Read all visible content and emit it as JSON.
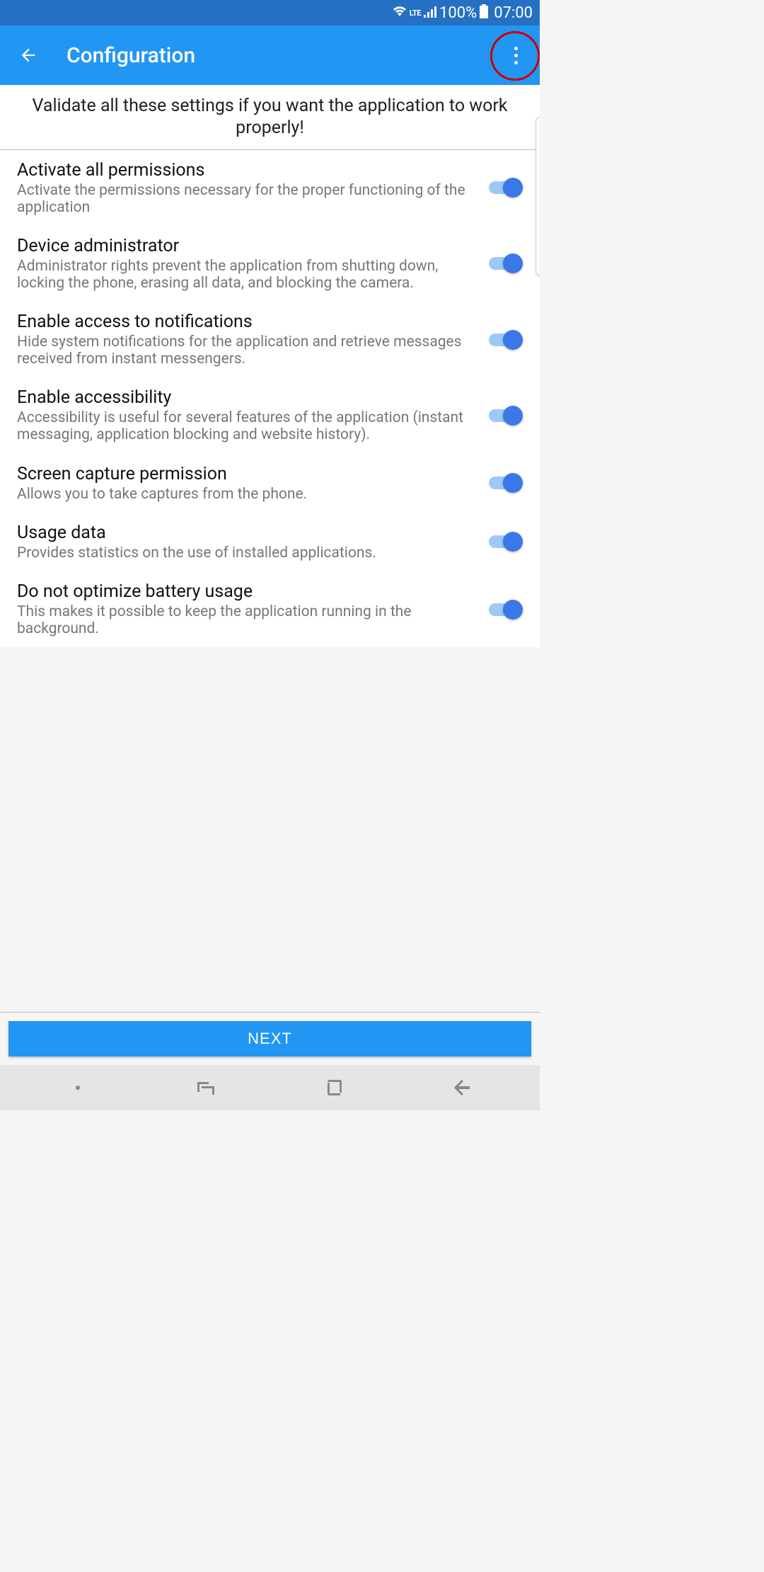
{
  "statusBar": {
    "network": "LTE",
    "batteryPct": "100%",
    "time": "07:00"
  },
  "header": {
    "title": "Configuration"
  },
  "instruction": "Validate all these settings if you want the application to work properly!",
  "settings": [
    {
      "title": "Activate all permissions",
      "desc": "Activate the permissions necessary for the proper functioning of the application",
      "on": true
    },
    {
      "title": "Device administrator",
      "desc": "Administrator rights prevent the application from shutting down, locking the phone, erasing all data, and blocking the camera.",
      "on": true
    },
    {
      "title": "Enable access to notifications",
      "desc": "Hide system notifications for the application and retrieve messages received from instant messengers.",
      "on": true
    },
    {
      "title": "Enable accessibility",
      "desc": "Accessibility is useful for several features of the application (instant messaging, application blocking and website history).",
      "on": true
    },
    {
      "title": "Screen capture permission",
      "desc": "Allows you to take captures from the phone.",
      "on": true
    },
    {
      "title": "Usage data",
      "desc": "Provides statistics on the use of installed applications.",
      "on": true
    },
    {
      "title": "Do not optimize battery usage",
      "desc": "This makes it possible to keep the application running in the background.",
      "on": true
    }
  ],
  "footer": {
    "nextLabel": "NEXT"
  }
}
